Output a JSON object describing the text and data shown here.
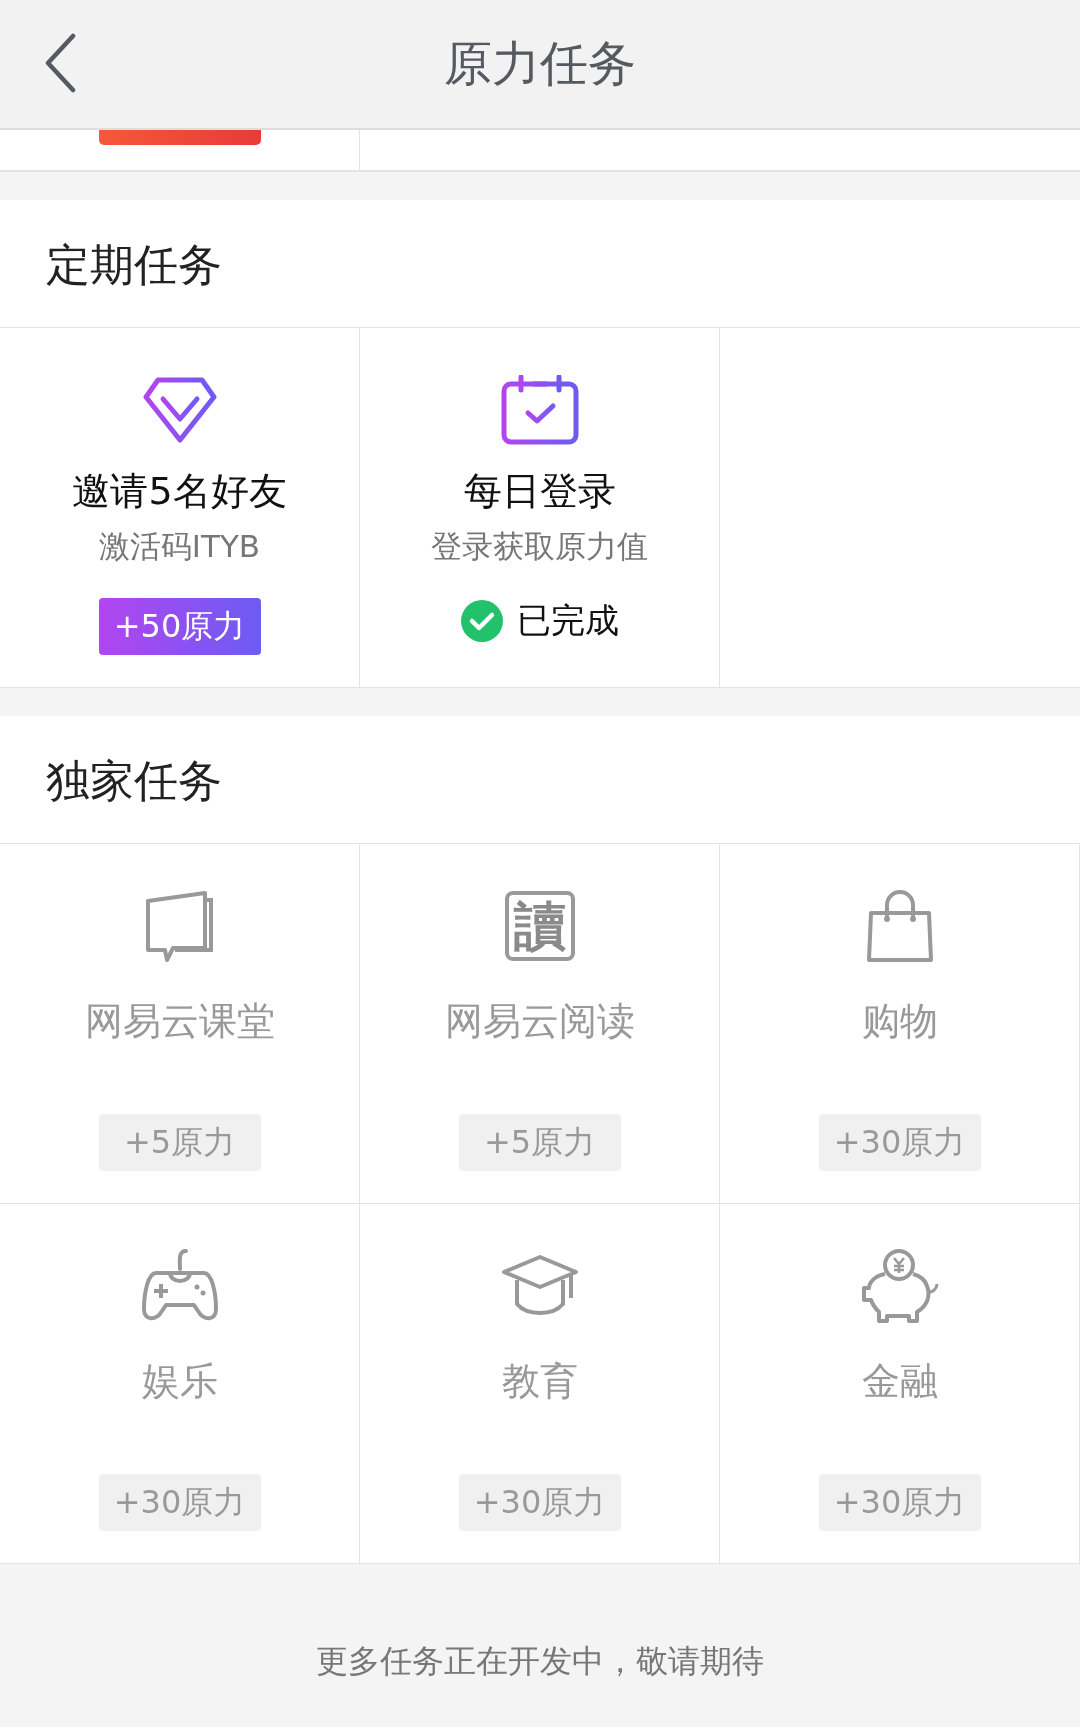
{
  "header": {
    "title": "原力任务"
  },
  "sections": [
    {
      "title": "定期任务",
      "tasks": [
        {
          "kind": "diamond",
          "title": "邀请5名好友",
          "subtitle": "激活码ITYB",
          "completed": false,
          "disabled": false,
          "reward": "+50原力"
        },
        {
          "kind": "calendar",
          "title": "每日登录",
          "subtitle": "登录获取原力值",
          "completed": true,
          "disabled": false,
          "status_text": "已完成"
        }
      ]
    },
    {
      "title": "独家任务",
      "tasks": [
        {
          "kind": "chat-book",
          "title": "网易云课堂",
          "completed": false,
          "disabled": true,
          "reward": "+5原力"
        },
        {
          "kind": "read-logo",
          "icon_text": "讀",
          "title": "网易云阅读",
          "completed": false,
          "disabled": true,
          "reward": "+5原力"
        },
        {
          "kind": "bag",
          "title": "购物",
          "completed": false,
          "disabled": true,
          "reward": "+30原力"
        },
        {
          "kind": "gamepad",
          "title": "娱乐",
          "completed": false,
          "disabled": true,
          "reward": "+30原力"
        },
        {
          "kind": "cap",
          "title": "教育",
          "completed": false,
          "disabled": true,
          "reward": "+30原力"
        },
        {
          "kind": "piggy",
          "title": "金融",
          "completed": false,
          "disabled": true,
          "reward": "+30原力"
        }
      ]
    }
  ],
  "footer": "更多任务正在开发中，敬请期待"
}
